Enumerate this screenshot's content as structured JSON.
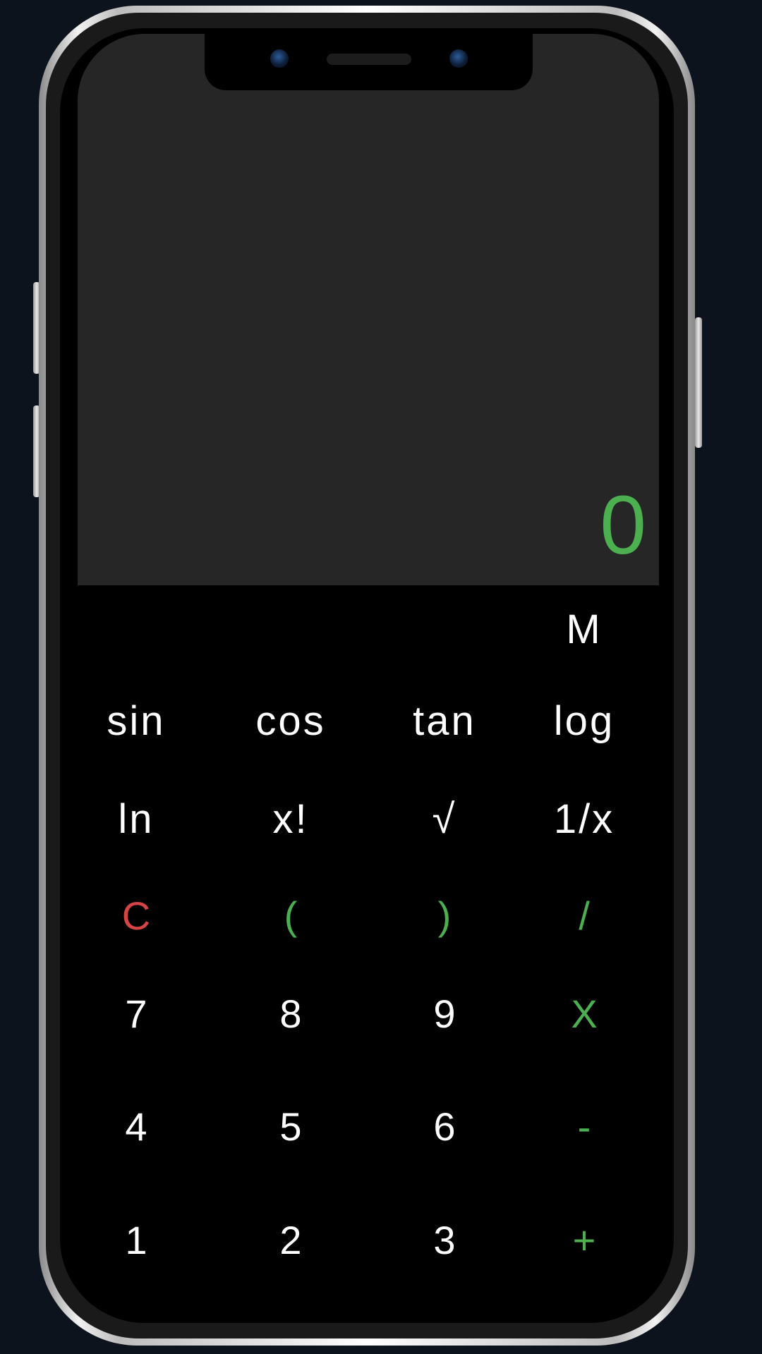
{
  "display": {
    "value": "0"
  },
  "keypad": {
    "memory": "M",
    "row_fn1": [
      "sin",
      "cos",
      "tan",
      "log"
    ],
    "row_fn2": [
      "ln",
      "x!",
      "√",
      "1/x"
    ],
    "row_ops": [
      "C",
      "(",
      ")",
      "/"
    ],
    "row_789": [
      "7",
      "8",
      "9",
      "X"
    ],
    "row_456": [
      "4",
      "5",
      "6",
      "-"
    ],
    "row_123": [
      "1",
      "2",
      "3",
      "+"
    ]
  },
  "colors": {
    "accent_green": "#4caf50",
    "clear_red": "#d64545",
    "display_bg": "#262626",
    "page_bg": "#0d131c"
  }
}
